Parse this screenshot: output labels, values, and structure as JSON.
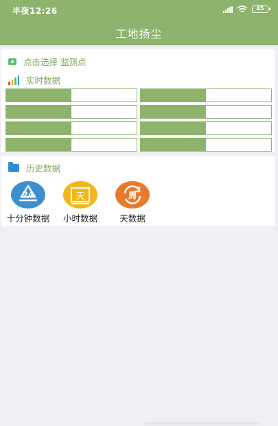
{
  "status": {
    "time": "半夜12:26",
    "battery": "45"
  },
  "header": {
    "title": "工地扬尘"
  },
  "select_point": {
    "label": "点击选择 监测点"
  },
  "realtime": {
    "label": "实时数据",
    "cells": [
      {
        "value": "",
        "fill": 0.5
      },
      {
        "value": "",
        "fill": 0.5
      },
      {
        "value": "",
        "fill": 0.5
      },
      {
        "value": "",
        "fill": 0.5
      },
      {
        "value": "",
        "fill": 0.5
      },
      {
        "value": "",
        "fill": 0.5
      },
      {
        "value": "",
        "fill": 0.5
      },
      {
        "value": "",
        "fill": 0.5
      }
    ]
  },
  "history": {
    "label": "历史数据",
    "shortcuts": [
      {
        "label": "十分钟数据",
        "icon": "recycle-24-icon",
        "color": "#3d8fd0",
        "glyph": "24"
      },
      {
        "label": "小时数据",
        "icon": "calendar-day-icon",
        "color": "#f4b41a",
        "glyph": "天"
      },
      {
        "label": "天数据",
        "icon": "refresh-week-icon",
        "color": "#e87a2a",
        "glyph": "周"
      }
    ]
  },
  "colors": {
    "accent": "#8db36d"
  }
}
